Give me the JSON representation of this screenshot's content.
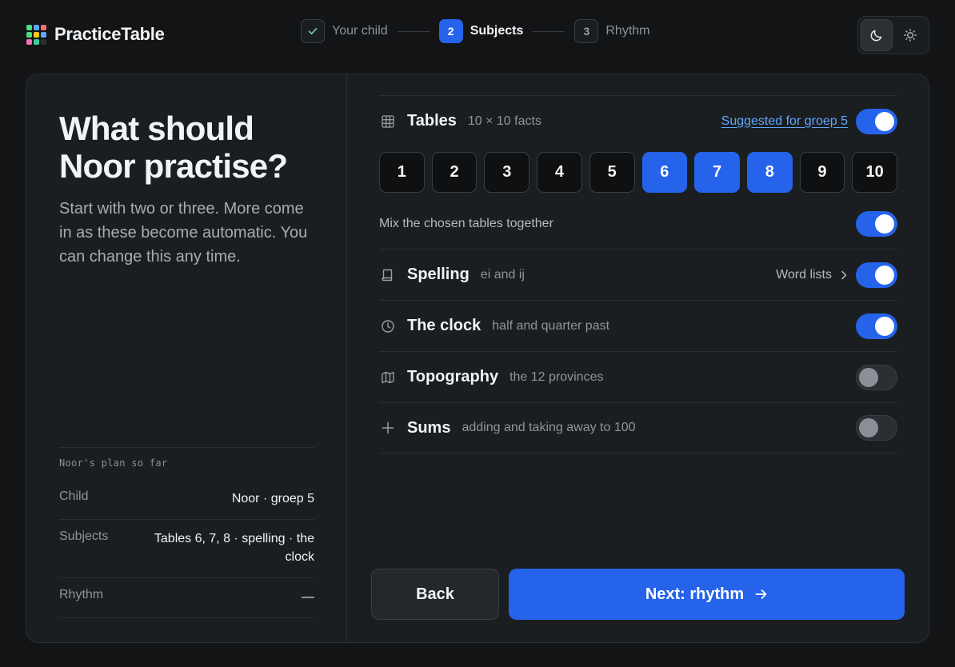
{
  "app": {
    "name": "PracticeTable"
  },
  "colors": {
    "accent": "#2563eb",
    "link": "#60a5fa",
    "logo": [
      "#4ade80",
      "#60a5fa",
      "#f87171",
      "#4ade80",
      "#facc15",
      "#60a5fa",
      "#f472b6",
      "#34d399",
      "#1b1e21"
    ]
  },
  "stepper": {
    "steps": [
      {
        "number": "1",
        "label": "Your child",
        "state": "done"
      },
      {
        "number": "2",
        "label": "Subjects",
        "state": "active"
      },
      {
        "number": "3",
        "label": "Rhythm",
        "state": "upcoming"
      }
    ]
  },
  "theme": {
    "dark_icon": "moon-icon",
    "light_icon": "sun-icon",
    "selected": "dark"
  },
  "left": {
    "heading": "What should Noor practise?",
    "intro": "Start with two or three. More come in as these become automatic. You can change this any time.",
    "plan_title": "Noor's plan so far",
    "plan": [
      {
        "key": "Child",
        "value": "Noor · groep 5"
      },
      {
        "key": "Subjects",
        "value": "Tables 6, 7, 8 · spelling · the clock"
      },
      {
        "key": "Rhythm",
        "value": "—"
      }
    ]
  },
  "subjects": {
    "tables": {
      "title": "Tables",
      "subtitle": "10 × 10 facts",
      "suggestion": "Suggested for groep 5",
      "enabled": true,
      "numbers": [
        "1",
        "2",
        "3",
        "4",
        "5",
        "6",
        "7",
        "8",
        "9",
        "10"
      ],
      "selected": [
        "6",
        "7",
        "8"
      ],
      "mix_label": "Mix the chosen tables together",
      "mix_enabled": true
    },
    "spelling": {
      "title": "Spelling",
      "subtitle": "ei and ij",
      "link": "Word lists",
      "enabled": true
    },
    "clock": {
      "title": "The clock",
      "subtitle": "half and quarter past",
      "enabled": true
    },
    "topography": {
      "title": "Topography",
      "subtitle": "the 12 provinces",
      "enabled": false
    },
    "sums": {
      "title": "Sums",
      "subtitle": "adding and taking away to 100",
      "enabled": false
    }
  },
  "actions": {
    "back": "Back",
    "next": "Next: rhythm"
  }
}
